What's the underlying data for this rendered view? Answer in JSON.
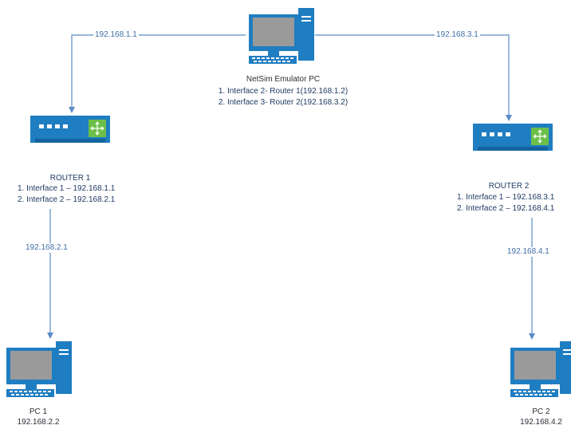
{
  "colors": {
    "line": "#5b8ac6",
    "device_blue": "#1f7dc1",
    "screen": "#9a9a9a",
    "router_accent": "#6cc04a"
  },
  "emulator": {
    "title": "NetSim Emulator PC",
    "interfaces": [
      "1. Interface 2- Router 1(192.168.1.2)",
      "2. Interface 3- Router 2(192.168.3.2)"
    ],
    "icon": "desktop-pc-icon"
  },
  "router1": {
    "title": "ROUTER 1",
    "interfaces": [
      "1. Interface 1 – 192.168.1.1",
      "2. Interface 2 – 192.168.2.1"
    ],
    "icon": "router-icon"
  },
  "router2": {
    "title": "ROUTER 2",
    "interfaces": [
      "1. Interface 1 – 192.168.3.1",
      "2. Interface 2 – 192.168.4.1"
    ],
    "icon": "router-icon"
  },
  "pc1": {
    "title": "PC 1",
    "ip": "192.168.2.2",
    "icon": "desktop-pc-icon"
  },
  "pc2": {
    "title": "PC 2",
    "ip": "192.168.4.2",
    "icon": "desktop-pc-icon"
  },
  "links": {
    "emu_r1": "192.168.1.1",
    "emu_r2": "192.168.3.1",
    "r1_pc1": "192.168.2.1",
    "r2_pc2": "192.168.4.1"
  }
}
